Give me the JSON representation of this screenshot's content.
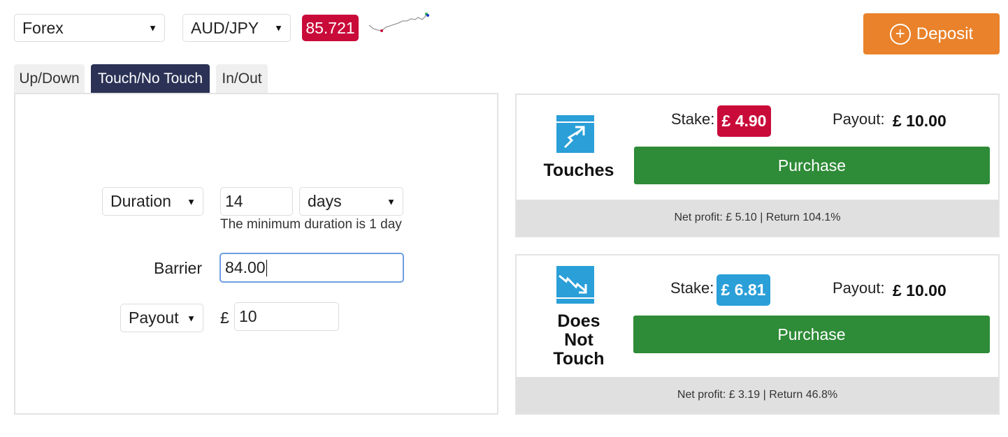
{
  "header": {
    "market_select": "Forex",
    "symbol_select": "AUD/JPY",
    "spot_price": "85.721",
    "deposit_label": "Deposit"
  },
  "tabs": [
    {
      "label": "Up/Down",
      "active": false
    },
    {
      "label": "Touch/No Touch",
      "active": true
    },
    {
      "label": "In/Out",
      "active": false
    }
  ],
  "form": {
    "duration_type": "Duration",
    "duration_value": "14",
    "duration_unit": "days",
    "duration_hint": "The minimum duration is 1 day",
    "barrier_label": "Barrier",
    "barrier_value": "84.00",
    "amount_type": "Payout",
    "currency_symbol": "£",
    "amount_value": "10"
  },
  "contracts": [
    {
      "title": "Touches",
      "icon": "touches-trend-up-icon",
      "stake_label": "Stake:",
      "stake_value": "£ 4.90",
      "stake_color": "#c90b3a",
      "payout_label": "Payout:",
      "payout_value": "£ 10.00",
      "purchase_label": "Purchase",
      "footer": "Net profit: £ 5.10 | Return 104.1%"
    },
    {
      "title_lines": [
        "Does",
        "Not",
        "Touch"
      ],
      "icon": "does-not-touch-trend-down-icon",
      "stake_label": "Stake:",
      "stake_value": "£ 6.81",
      "stake_color": "#2a9fd8",
      "payout_label": "Payout:",
      "payout_value": "£ 10.00",
      "purchase_label": "Purchase",
      "footer": "Net profit: £ 3.19 | Return 46.8%"
    }
  ],
  "colors": {
    "accent_orange": "#e9822a",
    "active_tab": "#2b3256",
    "purchase_green": "#2e8b37",
    "icon_blue": "#2a9fd8"
  }
}
